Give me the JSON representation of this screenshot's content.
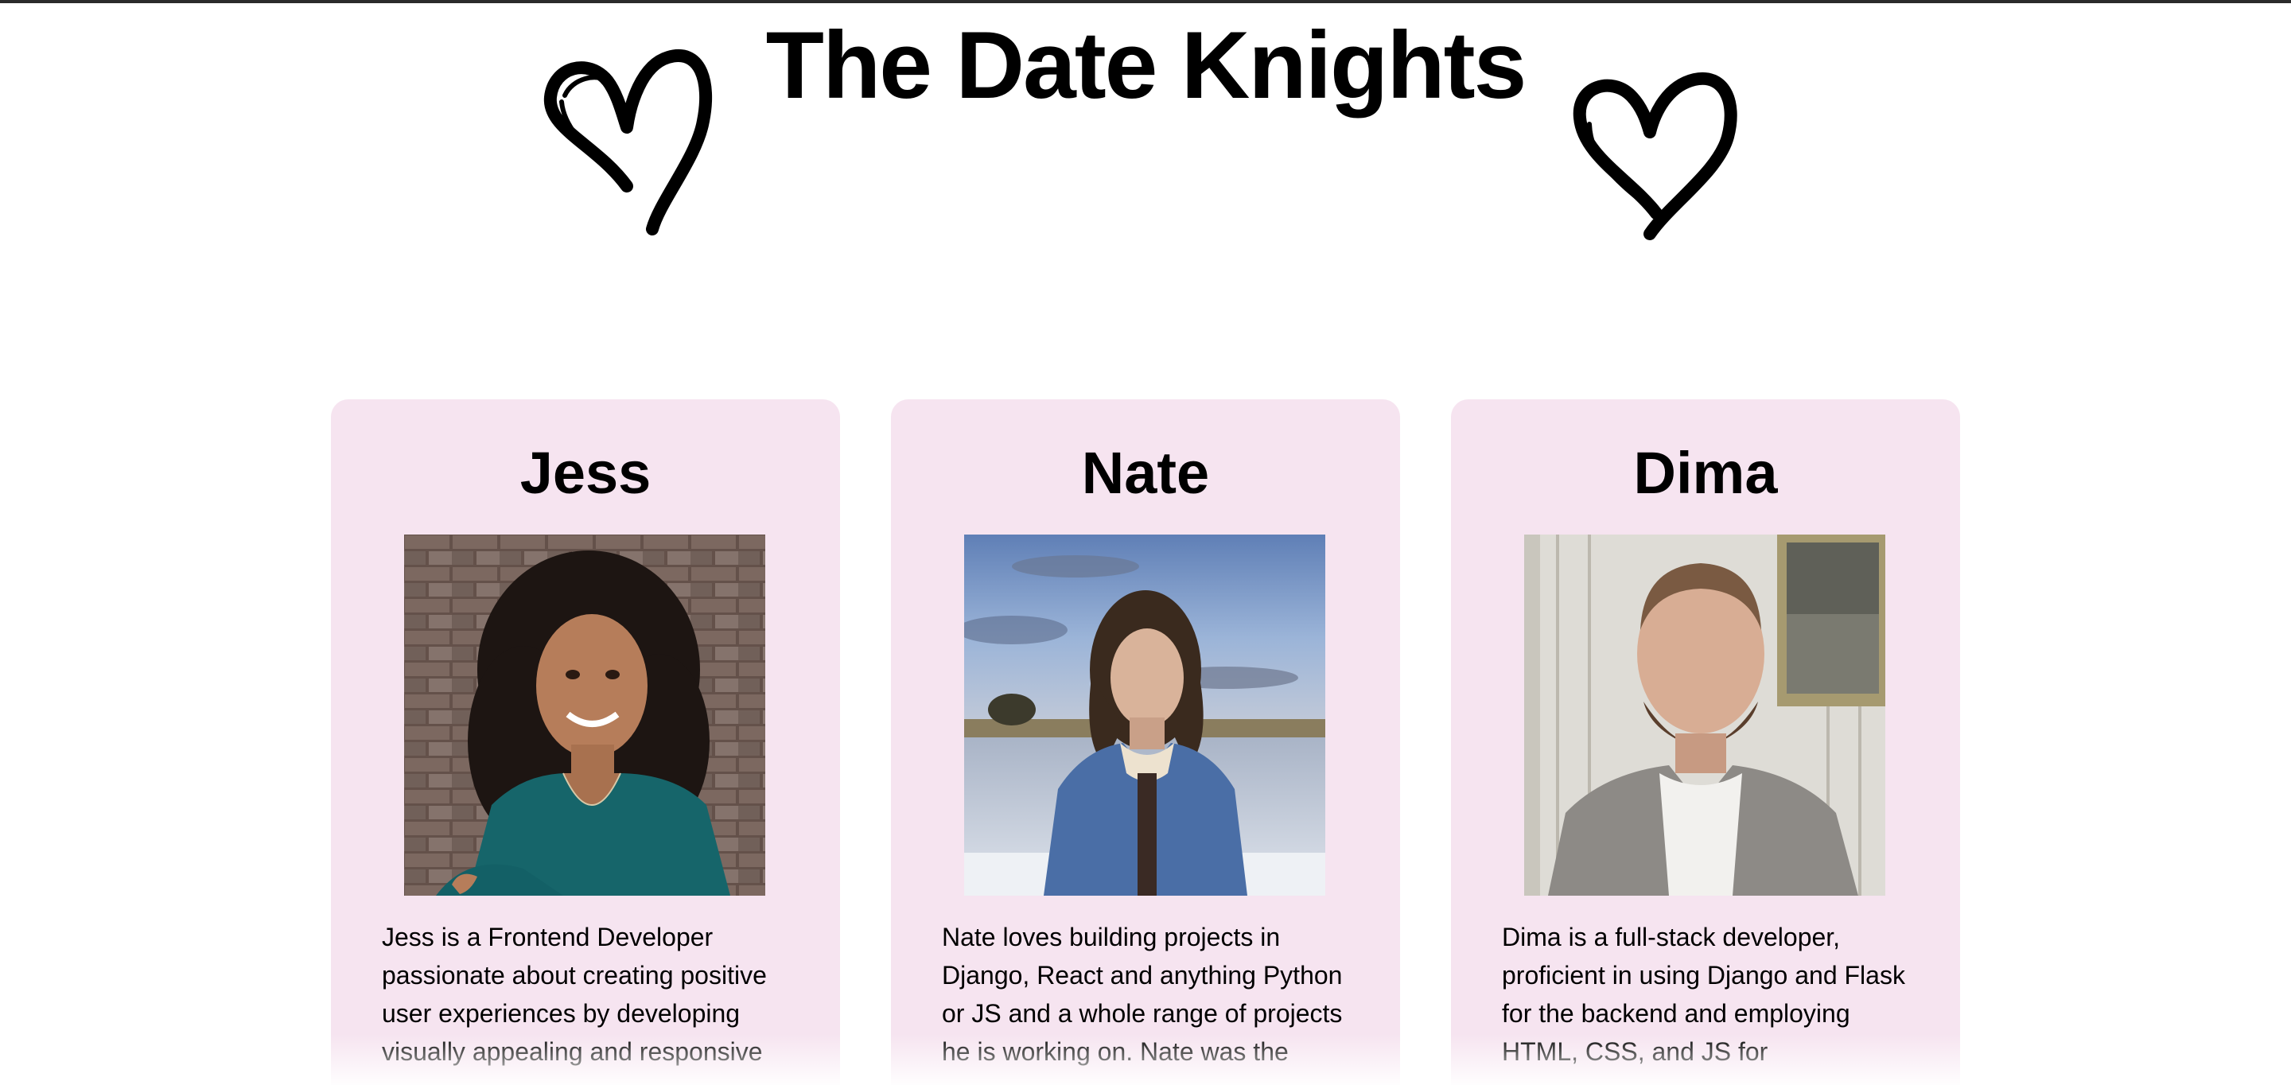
{
  "header": {
    "title": "The Date Knights"
  },
  "icons": {
    "left_heart": "heart-icon",
    "right_heart": "heart-icon"
  },
  "colors": {
    "card_background": "#f6e4f0",
    "page_background": "#ffffff",
    "text": "#000000"
  },
  "team": [
    {
      "name": "Jess",
      "bio": "Jess is a Frontend Developer passionate about creating positive user experiences by developing visually appealing and responsive"
    },
    {
      "name": "Nate",
      "bio": "Nate loves building projects in Django, React and anything Python or JS and a whole range of projects he is working on. Nate was the"
    },
    {
      "name": "Dima",
      "bio": "Dima is a full-stack developer, proficient in using Django and Flask for the backend and employing HTML, CSS, and JS for"
    }
  ]
}
